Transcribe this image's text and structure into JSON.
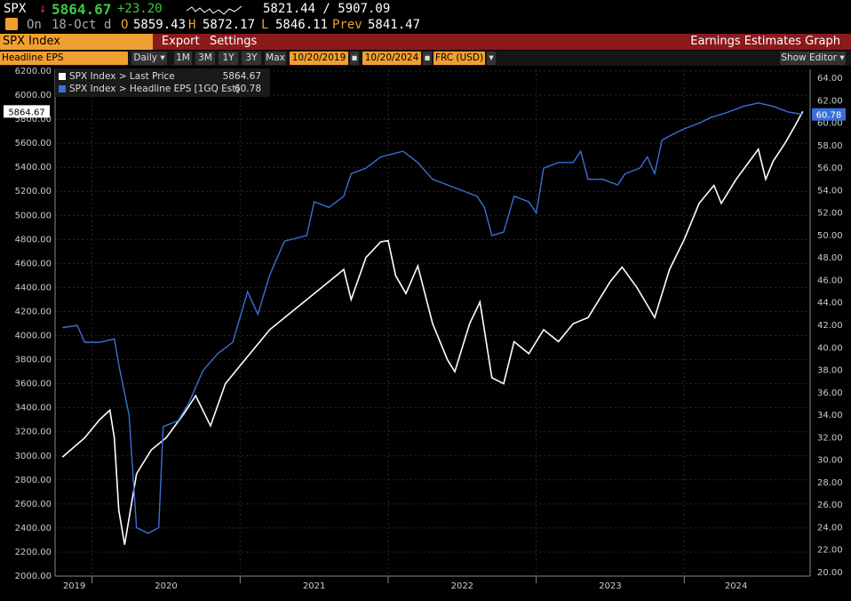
{
  "quote": {
    "ticker": "SPX",
    "arrow": "↓",
    "last": "5864.67",
    "change": "+23.20",
    "range": "5821.44 / 5907.09",
    "date_prefix": "On",
    "date": "18-Oct d",
    "open_label": "O",
    "open": "5859.43",
    "high_label": "H",
    "high": "5872.17",
    "low_label": "L",
    "low": "5846.11",
    "prev_label": "Prev",
    "prev": "5841.47"
  },
  "ticker_bar": {
    "security": "SPX Index",
    "export_label": "Export",
    "settings_label": "Settings",
    "function_title": "Earnings Estimates Graph"
  },
  "toolbar": {
    "field": "Headline EPS",
    "periodicity": "Daily",
    "ranges": [
      "1M",
      "3M",
      "1Y",
      "3Y",
      "Max"
    ],
    "start_date": "10/20/2019",
    "end_date": "10/20/2024",
    "currency": "FRC (USD)",
    "show_editor": "Show Editor"
  },
  "legend": [
    {
      "label": "SPX Index > Last Price",
      "value": "5864.67",
      "color": "#ffffff"
    },
    {
      "label": "SPX Index > Headline EPS [1GQ Est]",
      "value": "60.78",
      "color": "#3a6fd8"
    }
  ],
  "chart_data": {
    "type": "line",
    "x_labels": [
      "2019",
      "2020",
      "2021",
      "2022",
      "2023",
      "2024"
    ],
    "left_axis": {
      "min": 2000,
      "max": 6200,
      "step": 200,
      "ticks": [
        "2000.00",
        "2200.00",
        "2400.00",
        "2600.00",
        "2800.00",
        "3000.00",
        "3200.00",
        "3400.00",
        "3600.00",
        "3800.00",
        "4000.00",
        "4200.00",
        "4400.00",
        "4600.00",
        "4800.00",
        "5000.00",
        "5200.00",
        "5400.00",
        "5600.00",
        "5800.00",
        "6000.00",
        "6200.00"
      ]
    },
    "right_axis": {
      "min": 20,
      "max": 64,
      "step": 2,
      "ticks": [
        "20.00",
        "22.00",
        "24.00",
        "26.00",
        "28.00",
        "30.00",
        "32.00",
        "34.00",
        "36.00",
        "38.00",
        "40.00",
        "42.00",
        "44.00",
        "46.00",
        "48.00",
        "50.00",
        "52.00",
        "54.00",
        "56.00",
        "58.00",
        "60.00",
        "62.00",
        "64.00"
      ]
    },
    "grid": true,
    "series": [
      {
        "name": "SPX Index > Last Price",
        "color": "#ffffff",
        "axis": "left",
        "last_label": "5864.67",
        "points": [
          [
            2019.8,
            2990
          ],
          [
            2019.95,
            3150
          ],
          [
            2020.05,
            3300
          ],
          [
            2020.12,
            3380
          ],
          [
            2020.15,
            3150
          ],
          [
            2020.18,
            2550
          ],
          [
            2020.22,
            2260
          ],
          [
            2020.3,
            2850
          ],
          [
            2020.4,
            3050
          ],
          [
            2020.5,
            3150
          ],
          [
            2020.62,
            3350
          ],
          [
            2020.7,
            3500
          ],
          [
            2020.8,
            3250
          ],
          [
            2020.9,
            3600
          ],
          [
            2021.0,
            3750
          ],
          [
            2021.1,
            3900
          ],
          [
            2021.2,
            4050
          ],
          [
            2021.35,
            4200
          ],
          [
            2021.5,
            4350
          ],
          [
            2021.6,
            4450
          ],
          [
            2021.7,
            4550
          ],
          [
            2021.75,
            4300
          ],
          [
            2021.85,
            4650
          ],
          [
            2021.95,
            4780
          ],
          [
            2022.0,
            4790
          ],
          [
            2022.05,
            4500
          ],
          [
            2022.12,
            4350
          ],
          [
            2022.2,
            4580
          ],
          [
            2022.3,
            4100
          ],
          [
            2022.4,
            3800
          ],
          [
            2022.45,
            3700
          ],
          [
            2022.55,
            4100
          ],
          [
            2022.62,
            4280
          ],
          [
            2022.7,
            3650
          ],
          [
            2022.78,
            3600
          ],
          [
            2022.85,
            3950
          ],
          [
            2022.95,
            3850
          ],
          [
            2023.05,
            4050
          ],
          [
            2023.15,
            3950
          ],
          [
            2023.25,
            4100
          ],
          [
            2023.35,
            4150
          ],
          [
            2023.5,
            4450
          ],
          [
            2023.58,
            4570
          ],
          [
            2023.68,
            4400
          ],
          [
            2023.8,
            4150
          ],
          [
            2023.9,
            4550
          ],
          [
            2024.0,
            4800
          ],
          [
            2024.1,
            5100
          ],
          [
            2024.2,
            5250
          ],
          [
            2024.25,
            5100
          ],
          [
            2024.35,
            5300
          ],
          [
            2024.5,
            5550
          ],
          [
            2024.55,
            5300
          ],
          [
            2024.6,
            5450
          ],
          [
            2024.68,
            5600
          ],
          [
            2024.75,
            5750
          ],
          [
            2024.8,
            5864.67
          ]
        ]
      },
      {
        "name": "SPX Index > Headline EPS [1GQ Est]",
        "color": "#3a6fd8",
        "axis": "right",
        "last_label": "60.78",
        "points": [
          [
            2019.8,
            41.8
          ],
          [
            2019.9,
            42.0
          ],
          [
            2019.95,
            40.5
          ],
          [
            2020.05,
            40.5
          ],
          [
            2020.15,
            40.8
          ],
          [
            2020.18,
            38.5
          ],
          [
            2020.25,
            34.0
          ],
          [
            2020.3,
            24.0
          ],
          [
            2020.38,
            23.5
          ],
          [
            2020.45,
            24.0
          ],
          [
            2020.48,
            33.0
          ],
          [
            2020.58,
            33.5
          ],
          [
            2020.65,
            35.0
          ],
          [
            2020.75,
            38.0
          ],
          [
            2020.85,
            39.5
          ],
          [
            2020.95,
            40.5
          ],
          [
            2021.05,
            45.0
          ],
          [
            2021.12,
            43.0
          ],
          [
            2021.2,
            46.5
          ],
          [
            2021.3,
            49.5
          ],
          [
            2021.45,
            50.0
          ],
          [
            2021.5,
            53.0
          ],
          [
            2021.6,
            52.5
          ],
          [
            2021.7,
            53.5
          ],
          [
            2021.75,
            55.5
          ],
          [
            2021.85,
            56.0
          ],
          [
            2021.95,
            57.0
          ],
          [
            2022.1,
            57.5
          ],
          [
            2022.2,
            56.5
          ],
          [
            2022.3,
            55.0
          ],
          [
            2022.4,
            54.5
          ],
          [
            2022.5,
            54.0
          ],
          [
            2022.6,
            53.5
          ],
          [
            2022.65,
            52.5
          ],
          [
            2022.7,
            50.0
          ],
          [
            2022.78,
            50.3
          ],
          [
            2022.85,
            53.5
          ],
          [
            2022.95,
            53.0
          ],
          [
            2023.0,
            52.0
          ],
          [
            2023.05,
            56.0
          ],
          [
            2023.15,
            56.5
          ],
          [
            2023.25,
            56.5
          ],
          [
            2023.3,
            57.5
          ],
          [
            2023.35,
            55.0
          ],
          [
            2023.45,
            55.0
          ],
          [
            2023.55,
            54.5
          ],
          [
            2023.6,
            55.5
          ],
          [
            2023.7,
            56.0
          ],
          [
            2023.75,
            57.0
          ],
          [
            2023.8,
            55.5
          ],
          [
            2023.85,
            58.5
          ],
          [
            2023.92,
            59.0
          ],
          [
            2024.0,
            59.5
          ],
          [
            2024.1,
            60.0
          ],
          [
            2024.18,
            60.5
          ],
          [
            2024.3,
            61.0
          ],
          [
            2024.4,
            61.5
          ],
          [
            2024.5,
            61.8
          ],
          [
            2024.6,
            61.5
          ],
          [
            2024.7,
            61.0
          ],
          [
            2024.8,
            60.78
          ]
        ]
      }
    ]
  }
}
